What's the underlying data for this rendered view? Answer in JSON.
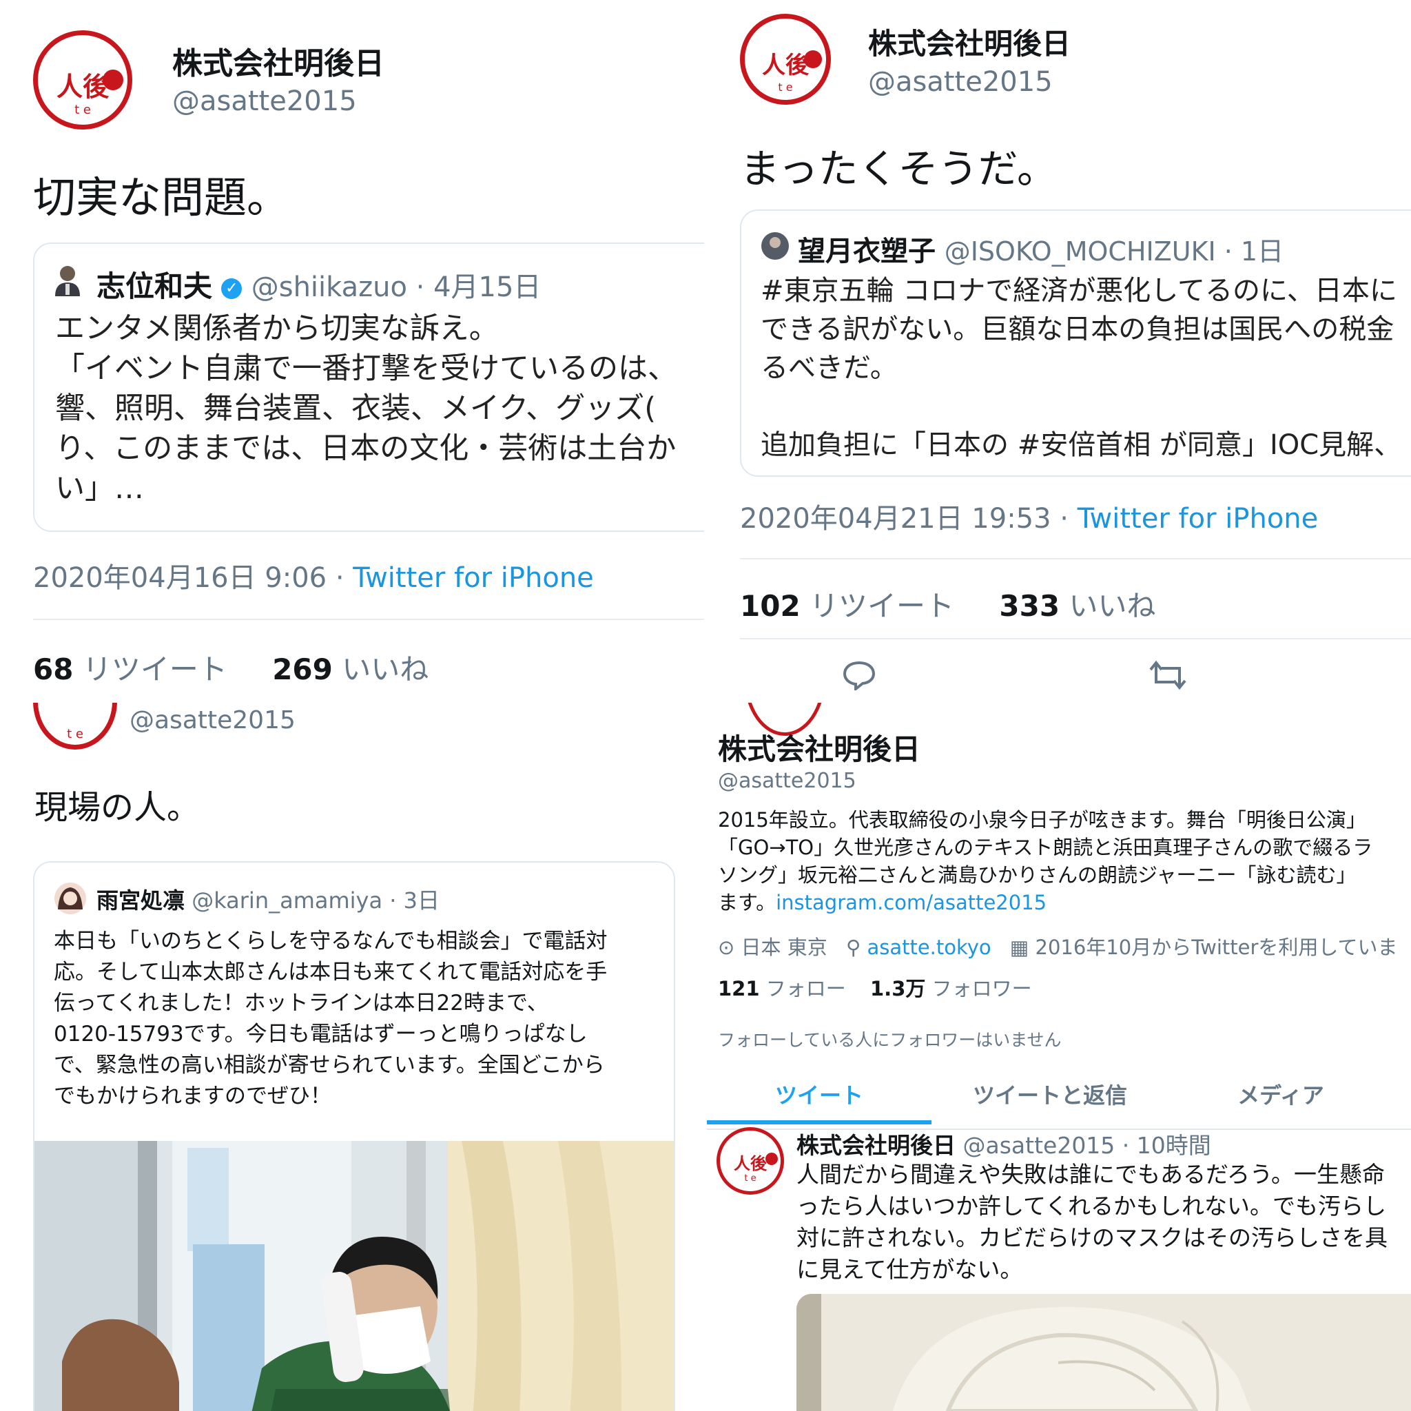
{
  "p1": {
    "author_name": "株式会社明後日",
    "author_handle": "@asatte2015",
    "body": "切実な問題。",
    "quote": {
      "name": "志位和夫",
      "handle_date": "@shiikazuo · 4月15日",
      "lines": [
        "エンタメ関係者から切実な訴え。",
        "「イベント自粛で一番打撃を受けているのは、",
        "響、照明、舞台装置、衣装、メイク、グッズ(",
        "り、このままでは、日本の文化・芸術は土台か",
        "い」…"
      ]
    },
    "timestamp": "2020年04月16日 9:06 · ",
    "source": "Twitter for iPhone",
    "retweets_count": "68",
    "retweets_label": "リツイート",
    "likes_count": "269",
    "likes_label": "いいね"
  },
  "p2": {
    "author_name": "株式会社明後日",
    "author_handle": "@asatte2015",
    "body": "まったくそうだ。",
    "quote": {
      "name": "望月衣塑子",
      "handle_date": "@ISOKO_MOCHIZUKI · 1日",
      "lines": [
        "#東京五輪 コロナで経済が悪化してるのに、日本に",
        "できる訳がない。巨額な日本の負担は国民への税金",
        "るべきだ。",
        "",
        "追加負担に「日本の #安倍首相 が同意」IOC見解、"
      ]
    },
    "timestamp": "2020年04月21日 19:53 · ",
    "source": "Twitter for iPhone",
    "retweets_count": "102",
    "retweets_label": "リツイート",
    "likes_count": "333",
    "likes_label": "いいね",
    "actions": {
      "reply_icon": "reply-icon",
      "retweet_icon": "retweet-icon"
    }
  },
  "p3": {
    "author_handle": "@asatte2015",
    "body": "現場の人。",
    "quote": {
      "name": "雨宮処凛",
      "handle_date": "@karin_amamiya · 3日",
      "lines": [
        "本日も「いのちとくらしを守るなんでも相談会」で電話対",
        "応。そして山本太郎さんは本日も来てくれて電話対応を手",
        "伝ってくれました！ホットラインは本日22時まで、",
        "0120-15793です。今日も電話はずーっと鳴りっぱなし",
        "で、緊急性の高い相談が寄せられています。全国どこから",
        "でもかけられますのでぜひ！"
      ]
    }
  },
  "p4": {
    "profile_name": "株式会社明後日",
    "profile_handle": "@asatte2015",
    "bio_lines": [
      "2015年設立。代表取締役の小泉今日子が呟きます。舞台「明後日公演」",
      "「GO→TO」久世光彦さんのテキスト朗読と浜田真理子さんの歌で綴るラ",
      "ソング」坂元裕二さんと満島ひかりさんの朗読ジャーニー「詠む読む」"
    ],
    "bio_end": "ます。",
    "bio_link": "instagram.com/asatte2015",
    "location": "日本 東京",
    "website": "asatte.tokyo",
    "joined": "2016年10月からTwitterを利用していま",
    "following_count": "121",
    "following_label": "フォロー",
    "followers_count": "1.3万",
    "followers_label": "フォロワー",
    "known_followers": "フォローしている人にフォロワーはいません",
    "tabs": [
      "ツイート",
      "ツイートと返信",
      "メディア"
    ],
    "tweet": {
      "name": "株式会社明後日",
      "handle_time": "@asatte2015 · 10時間",
      "lines": [
        "人間だから間違えや失敗は誰にでもあるだろう。一生懸命",
        "ったら人はいつか許してくれるかもしれない。でも汚らし",
        "対に許されない。カビだらけのマスクはその汚らしさを具",
        "に見えて仕方がない。"
      ]
    }
  },
  "logo": {
    "mark": "人後",
    "sub": "t e"
  },
  "colors": {
    "brand_red": "#c8161d",
    "link_blue": "#1b95e0",
    "text_grey": "#657786"
  }
}
